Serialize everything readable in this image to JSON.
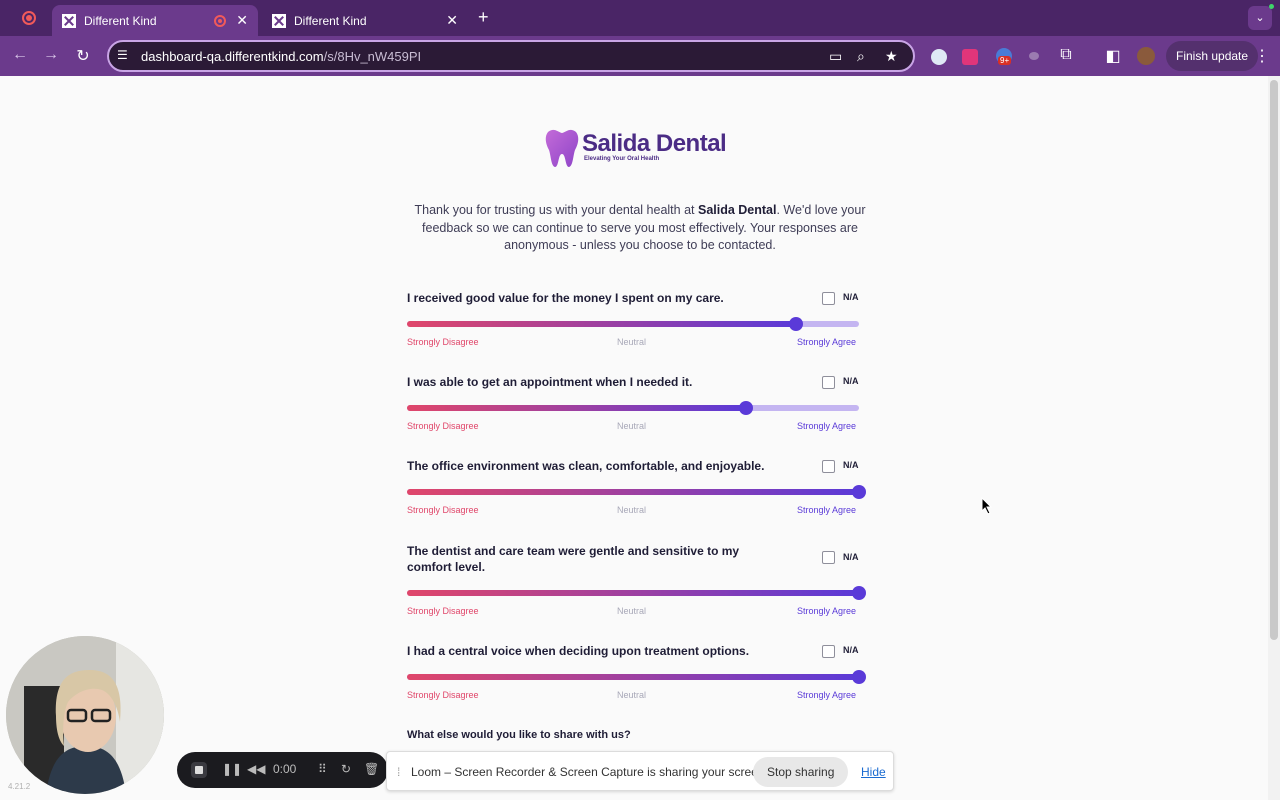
{
  "browser": {
    "tabs": [
      {
        "title": "Different Kind",
        "active": true,
        "recording": true
      },
      {
        "title": "Different Kind",
        "active": false,
        "recording": false
      }
    ],
    "new_tab_icon": "plus-icon",
    "url_host": "dashboard-qa.differentkind.com",
    "url_path": "/s/8Hv_nW459PI",
    "extension_badge": "9+",
    "finish_update_label": "Finish update"
  },
  "page": {
    "logo_name": "Salida Dental",
    "logo_tagline": "Elevating Your Oral Health",
    "intro_before": "Thank you for trusting us with your dental health at ",
    "intro_brand": "Salida Dental",
    "intro_after": ". We'd love your feedback so we can continue to serve you most effectively. Your responses are anonymous - unless you choose to be contacted.",
    "na_label": "N/A",
    "scale_labels": {
      "low": "Strongly Disagree",
      "mid": "Neutral",
      "high": "Strongly Agree"
    },
    "questions": [
      {
        "text": "I received good value for the money I spent on my care.",
        "value": 0.86
      },
      {
        "text": "I was able to get an appointment when I needed it.",
        "value": 0.75
      },
      {
        "text": "The office environment was clean, comfortable, and enjoyable.",
        "value": 1.0
      },
      {
        "text": "The dentist and care team were gentle and sensitive to my comfort level.",
        "value": 1.0
      },
      {
        "text": "I had a central voice when deciding upon treatment options.",
        "value": 1.0
      }
    ],
    "share_prompt": "What else would you like to share with us?"
  },
  "loom": {
    "timer": "0:00",
    "version": "4.21.2",
    "sharing_message": "Loom – Screen Recorder & Screen Capture is sharing your screen.",
    "stop_sharing_label": "Stop sharing",
    "hide_label": "Hide"
  },
  "colors": {
    "brand": "#4b2c85",
    "slider_start": "#e0466a",
    "slider_end": "#5a3ad8",
    "chrome": "#6b3a8c"
  }
}
